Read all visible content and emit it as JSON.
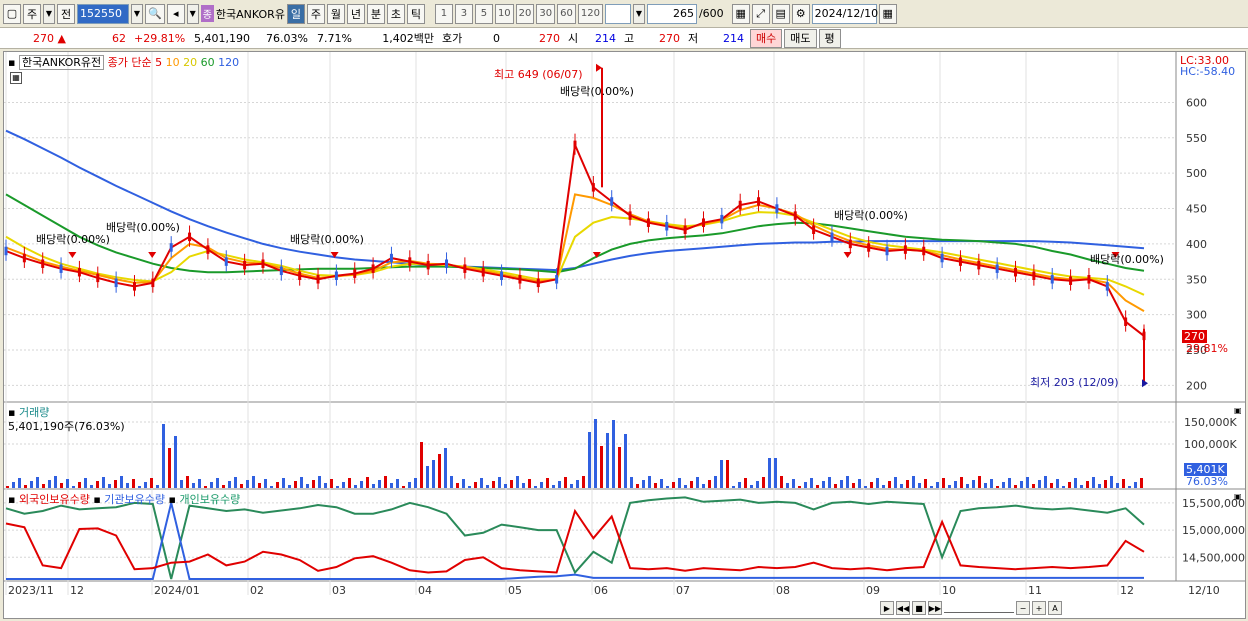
{
  "toolbar": {
    "market": "주",
    "prev": "전",
    "code": "152550",
    "jong": "종",
    "stock_short": "한국ANKOR유",
    "periods": [
      "일",
      "주",
      "월",
      "년",
      "분",
      "초",
      "틱"
    ],
    "minutes": [
      "1",
      "3",
      "5",
      "10",
      "20",
      "30",
      "60",
      "120"
    ],
    "counter": "265",
    "counter_total": "/600",
    "date": "2024/12/10"
  },
  "quote": {
    "price": "270",
    "change": "62",
    "change_rate": "+29.81%",
    "volume": "5,401,190",
    "vol_ratio": "76.03%",
    "turnover": "7.71%",
    "amount": "1,402백만",
    "hoga_label": "호가",
    "hoga_val": "0",
    "hoga_price": "270",
    "open_label": "시",
    "open": "214",
    "high_label": "고",
    "high": "270",
    "low_label": "저",
    "low": "214",
    "buy": "매수",
    "sell": "매도",
    "eval": "평"
  },
  "price_panel": {
    "stock_name": "한국ANKOR유전",
    "ma_label": "종가 단순",
    "ma": [
      {
        "p": "5",
        "color": "#e00000"
      },
      {
        "p": "10",
        "color": "#ff9900"
      },
      {
        "p": "20",
        "color": "#e8d800"
      },
      {
        "p": "60",
        "color": "#1a9a2a"
      },
      {
        "p": "120",
        "color": "#3060e0"
      }
    ],
    "lc": "LC:33.00",
    "hc": "HC:-58.40",
    "high_note": "최고 649 (06/07)",
    "low_note": "최저 203 (12/09)",
    "dividend": "배당락(0.00%)",
    "current": "270",
    "current_rate": "29.81%"
  },
  "volume_panel": {
    "title": "거래량",
    "value": "5,401,190주(76.03%)",
    "current": "5,401K",
    "current_rate": "76.03%"
  },
  "holding_panel": {
    "legends": [
      {
        "name": "외국인보유수량",
        "color": "#e00000"
      },
      {
        "name": "기관보유수량",
        "color": "#3060e0"
      },
      {
        "name": "개인보유수량",
        "color": "#1a9a6a"
      }
    ]
  },
  "chart_data": {
    "type": "line",
    "price_axis": [
      200,
      250,
      300,
      350,
      400,
      450,
      500,
      550,
      600
    ],
    "volume_axis": [
      "100,000K",
      "150,000K"
    ],
    "holding_axis": [
      "14,500,000",
      "15,000,000",
      "15,500,000"
    ],
    "x_labels": [
      "2023/11",
      "12",
      "2024/01",
      "02",
      "03",
      "04",
      "05",
      "06",
      "07",
      "08",
      "09",
      "10",
      "11",
      "12",
      "12/10"
    ],
    "ma5": [
      390,
      380,
      372,
      365,
      360,
      352,
      345,
      340,
      345,
      395,
      410,
      392,
      375,
      370,
      372,
      362,
      355,
      350,
      355,
      358,
      365,
      380,
      375,
      370,
      372,
      365,
      360,
      355,
      350,
      345,
      350,
      540,
      480,
      460,
      440,
      430,
      425,
      420,
      430,
      435,
      455,
      460,
      450,
      440,
      420,
      410,
      400,
      395,
      390,
      392,
      390,
      380,
      375,
      370,
      365,
      360,
      355,
      350,
      348,
      350,
      340,
      290,
      270
    ],
    "ma10": [
      395,
      385,
      375,
      368,
      362,
      356,
      350,
      345,
      346,
      380,
      400,
      395,
      380,
      374,
      372,
      366,
      358,
      352,
      354,
      357,
      362,
      374,
      376,
      372,
      371,
      367,
      362,
      357,
      352,
      347,
      350,
      470,
      465,
      455,
      442,
      432,
      426,
      422,
      428,
      434,
      448,
      455,
      450,
      442,
      426,
      414,
      404,
      398,
      393,
      392,
      390,
      384,
      378,
      373,
      368,
      363,
      358,
      353,
      350,
      350,
      345,
      320,
      305
    ],
    "ma20": [
      410,
      395,
      382,
      372,
      365,
      358,
      353,
      349,
      347,
      360,
      382,
      390,
      384,
      378,
      374,
      369,
      362,
      356,
      355,
      356,
      360,
      368,
      372,
      371,
      370,
      368,
      364,
      360,
      355,
      350,
      350,
      410,
      430,
      438,
      436,
      432,
      428,
      425,
      427,
      432,
      440,
      445,
      444,
      440,
      430,
      420,
      410,
      403,
      398,
      395,
      392,
      388,
      383,
      378,
      373,
      368,
      363,
      358,
      354,
      352,
      350,
      340,
      328
    ],
    "ma60": [
      470,
      455,
      440,
      425,
      410,
      398,
      388,
      380,
      372,
      366,
      362,
      360,
      360,
      361,
      362,
      363,
      364,
      365,
      365,
      365,
      366,
      367,
      368,
      368,
      368,
      367,
      366,
      365,
      364,
      362,
      360,
      365,
      380,
      392,
      400,
      405,
      408,
      410,
      412,
      415,
      420,
      425,
      428,
      430,
      429,
      426,
      422,
      418,
      414,
      410,
      408,
      406,
      405,
      404,
      402,
      400,
      396,
      390,
      385,
      378,
      372,
      366,
      362
    ],
    "ma120": [
      560,
      548,
      535,
      522,
      508,
      495,
      482,
      470,
      458,
      446,
      435,
      425,
      416,
      408,
      400,
      394,
      389,
      385,
      381,
      378,
      376,
      374,
      372,
      370,
      369,
      368,
      367,
      366,
      365,
      364,
      363,
      366,
      372,
      378,
      383,
      387,
      390,
      392,
      394,
      396,
      398,
      400,
      401,
      402,
      402,
      403,
      403,
      404,
      404,
      404,
      404,
      404,
      404,
      404,
      404,
      404,
      404,
      403,
      402,
      400,
      398,
      396,
      394
    ],
    "dividends": [
      {
        "x": 0.06
      },
      {
        "x": 0.13
      },
      {
        "x": 0.29
      },
      {
        "x": 0.52
      },
      {
        "x": 0.74
      },
      {
        "x": 0.975
      }
    ],
    "foreign_holdings": [
      15.12,
      15.05,
      14.35,
      14.3,
      15.02,
      15.03,
      14.9,
      14.28,
      14.3,
      14.4,
      14.42,
      14.55,
      14.35,
      14.42,
      14.6,
      14.55,
      14.45,
      14.25,
      14.32,
      14.48,
      14.52,
      14.4,
      14.26,
      14.22,
      14.24,
      14.45,
      14.5,
      14.3,
      14.26,
      14.24,
      14.22,
      15.35,
      14.85,
      15.25,
      14.3,
      14.28,
      14.3,
      14.25,
      14.3,
      14.28,
      14.26,
      14.32,
      14.3,
      14.32,
      14.4,
      14.3,
      14.28,
      14.3,
      14.26,
      14.3,
      14.32,
      15.15,
      14.35,
      14.32,
      14.3,
      14.28,
      14.3,
      14.32,
      14.3,
      14.32,
      14.35,
      14.8,
      14.6
    ],
    "institution_holdings": [
      14.1,
      14.1,
      14.1,
      14.1,
      14.1,
      14.1,
      14.1,
      14.1,
      14.1,
      15.5,
      14.1,
      14.1,
      14.1,
      14.1,
      14.1,
      14.1,
      14.1,
      14.1,
      14.1,
      14.1,
      14.1,
      14.1,
      14.1,
      14.1,
      14.1,
      14.1,
      14.1,
      14.1,
      14.12,
      14.14,
      14.15,
      14.18,
      14.12,
      14.12,
      14.12,
      14.12,
      14.12,
      14.12,
      14.12,
      14.12,
      14.12,
      14.12,
      14.12,
      14.12,
      14.12,
      14.12,
      14.12,
      14.12,
      14.12,
      14.12,
      14.12,
      14.12,
      14.12,
      14.12,
      14.12,
      14.12,
      14.12,
      14.12,
      14.12,
      14.12,
      14.12,
      14.12,
      14.12
    ],
    "individual_holdings": [
      15.4,
      15.3,
      15.35,
      15.45,
      15.38,
      15.4,
      15.42,
      15.5,
      15.48,
      14.1,
      15.45,
      15.4,
      15.35,
      15.38,
      15.32,
      15.36,
      15.4,
      15.46,
      15.42,
      15.3,
      15.3,
      15.38,
      15.5,
      15.42,
      15.3,
      14.9,
      14.95,
      15.1,
      15.05,
      15.0,
      15.0,
      14.22,
      14.6,
      14.4,
      15.5,
      15.55,
      15.58,
      15.6,
      15.52,
      15.54,
      15.56,
      15.5,
      15.52,
      15.5,
      15.38,
      15.5,
      15.52,
      15.48,
      15.52,
      15.5,
      15.48,
      14.5,
      15.35,
      15.4,
      15.42,
      15.45,
      15.4,
      15.38,
      15.4,
      15.36,
      15.32,
      15.4,
      15.1
    ]
  }
}
